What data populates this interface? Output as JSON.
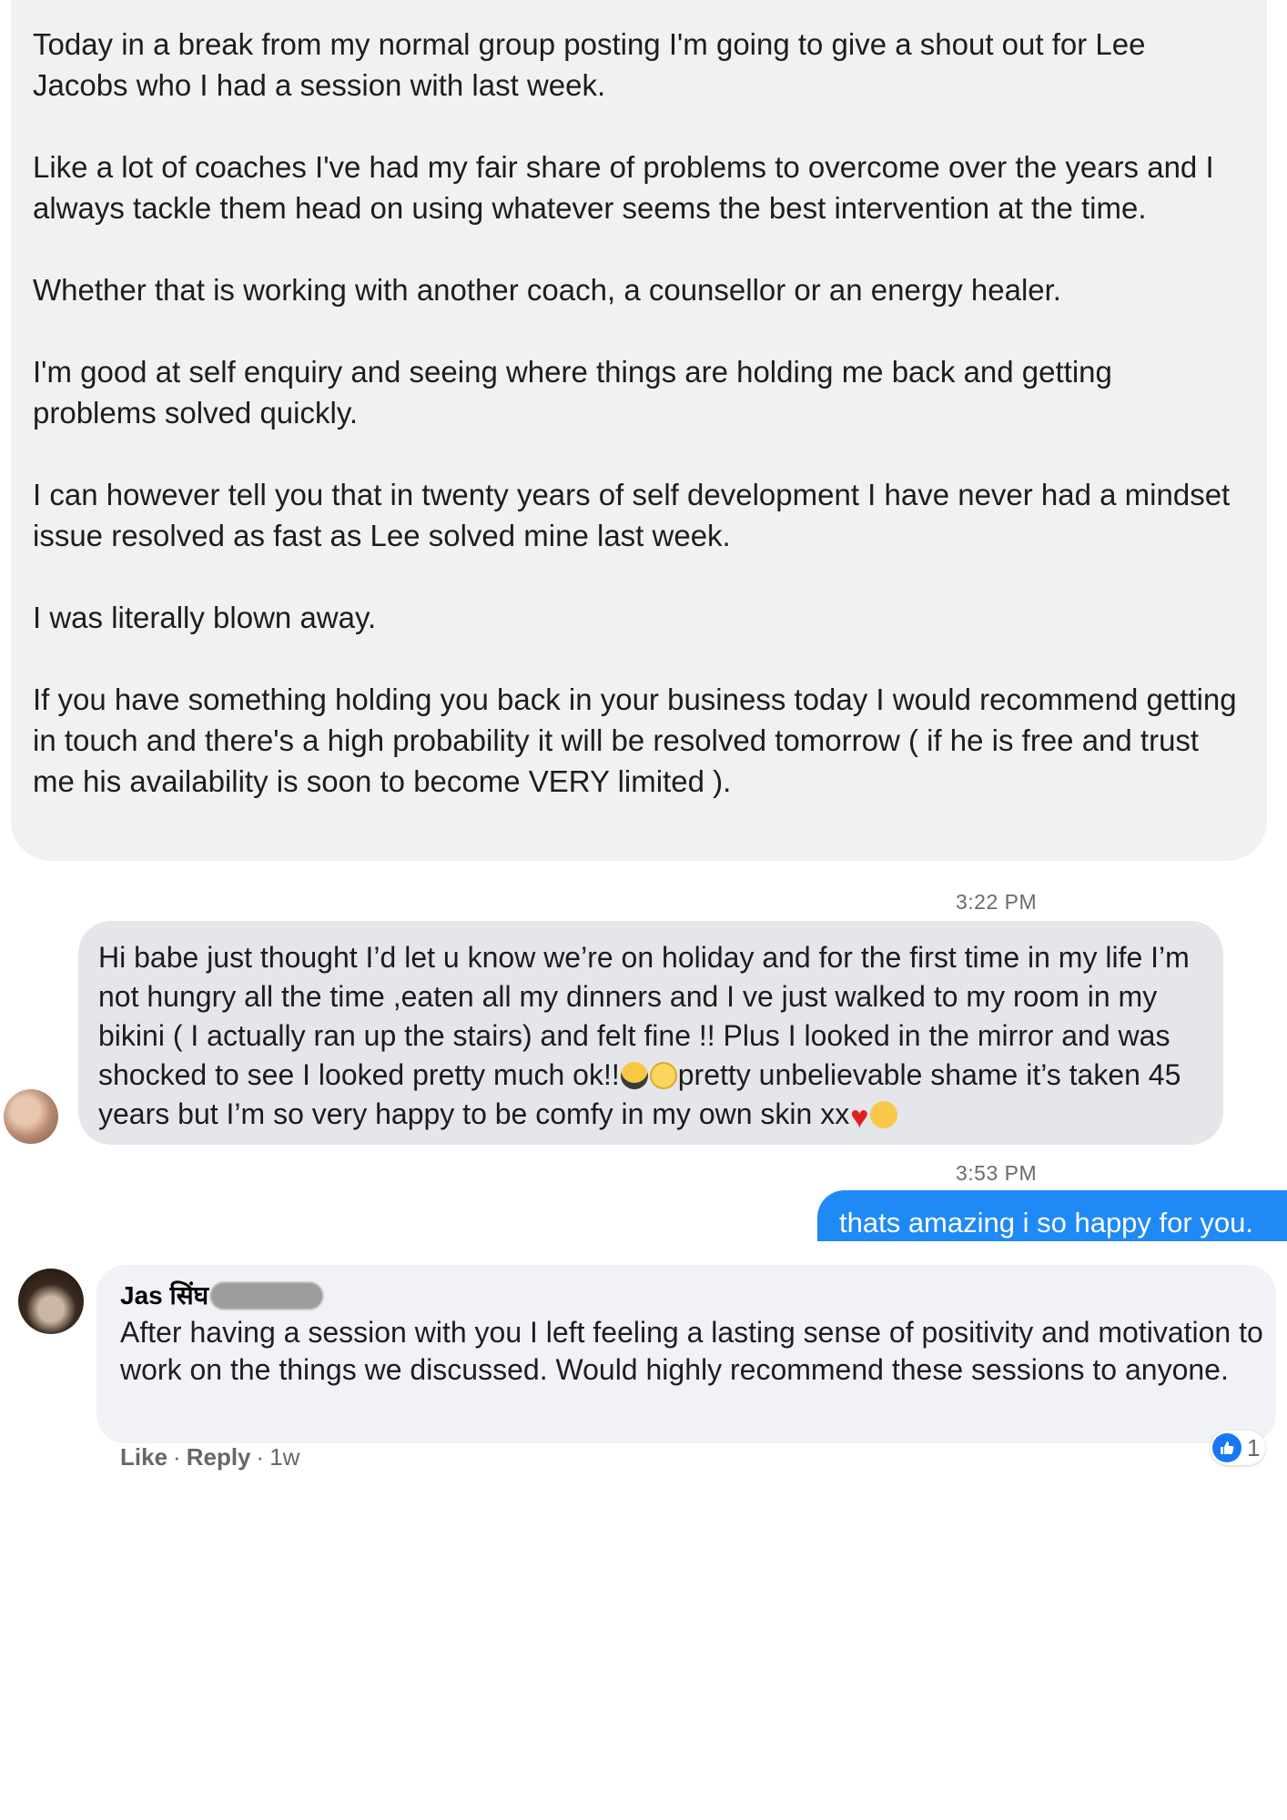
{
  "post": {
    "paragraphs": [
      "Today in a break from my normal group posting I'm going to give a shout out for Lee Jacobs who I had a session with last week.",
      "Like a lot of coaches I've had my fair share of problems to overcome over the years and I always tackle them head on using whatever seems the best intervention at the time.",
      "Whether that is working with another coach, a counsellor or an energy healer.",
      "I'm good at self enquiry and seeing where things are holding me back and getting problems solved quickly.",
      "I can however tell you that in twenty years of self development I have never had a mindset issue resolved as fast as Lee solved mine last week.",
      "I was literally blown away.",
      "If you have something holding you back in your business today I would recommend getting in touch and there's a high probability it will be resolved tomorrow ( if he is free and trust me his availability is soon to become VERY limited )."
    ]
  },
  "chat": {
    "timestamp1": "3:22 PM",
    "received_message": {
      "part1": "Hi babe just thought I’d let u know we’re on holiday and for the first time in my life I’m not hungry all the time ,eaten all my dinners  and I ve just walked to my room in my bikini ( I actually ran up the stairs) and felt fine !! Plus I looked in the mirror and was shocked to see I looked pretty much ok!!",
      "part2": "pretty unbelievable shame it’s taken 45 years but I’m so very happy to be comfy in my own skin xx",
      "emojis": [
        "sunglasses-face",
        "grinning-face",
        "red-heart",
        "kissing-face"
      ]
    },
    "timestamp2": "3:53 PM",
    "sent_message": "thats amazing i so happy for you."
  },
  "comment": {
    "author": "Jas सिंघ",
    "text": "After having a session with you I left feeling a lasting sense of positivity and motivation to work on the things we discussed. Would highly recommend these sessions to anyone.",
    "actions": {
      "like": "Like",
      "reply": "Reply",
      "time": "1w"
    },
    "reaction_count": "1"
  },
  "colors": {
    "sent_bubble": "#1f8af5",
    "like_badge": "#1877f2"
  }
}
